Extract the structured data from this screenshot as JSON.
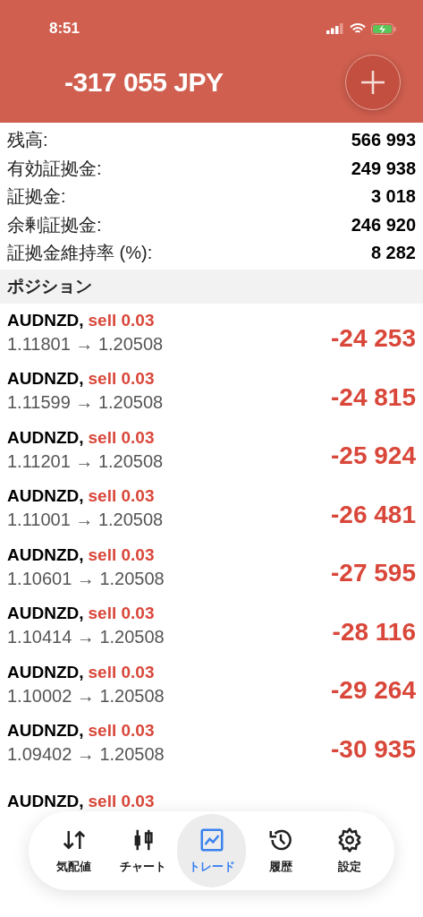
{
  "status_bar": {
    "time": "8:51"
  },
  "header": {
    "balance": "-317 055 JPY"
  },
  "summary": [
    {
      "label": "残高:",
      "value": "566 993"
    },
    {
      "label": "有効証拠金:",
      "value": "249 938"
    },
    {
      "label": "証拠金:",
      "value": "3 018"
    },
    {
      "label": "余剰証拠金:",
      "value": "246 920"
    },
    {
      "label": "証拠金維持率 (%):",
      "value": "8 282"
    }
  ],
  "positions": {
    "title": "ポジション",
    "rows": [
      {
        "symbol": "AUDNZD,",
        "trade": "sell 0.03",
        "prices": "1.11801 → 1.20508",
        "profit": "-24 253"
      },
      {
        "symbol": "AUDNZD,",
        "trade": "sell 0.03",
        "prices": "1.11599 → 1.20508",
        "profit": "-24 815"
      },
      {
        "symbol": "AUDNZD,",
        "trade": "sell 0.03",
        "prices": "1.11201 → 1.20508",
        "profit": "-25 924"
      },
      {
        "symbol": "AUDNZD,",
        "trade": "sell 0.03",
        "prices": "1.11001 → 1.20508",
        "profit": "-26 481"
      },
      {
        "symbol": "AUDNZD,",
        "trade": "sell 0.03",
        "prices": "1.10601 → 1.20508",
        "profit": "-27 595"
      },
      {
        "symbol": "AUDNZD,",
        "trade": "sell 0.03",
        "prices": "1.10414 → 1.20508",
        "profit": "-28 116"
      },
      {
        "symbol": "AUDNZD,",
        "trade": "sell 0.03",
        "prices": "1.10002 → 1.20508",
        "profit": "-29 264"
      },
      {
        "symbol": "AUDNZD,",
        "trade": "sell 0.03",
        "prices": "1.09402 → 1.20508",
        "profit": "-30 935"
      },
      {
        "symbol": "AUDNZD,",
        "trade": "sell 0.03"
      }
    ]
  },
  "tab_bar": [
    {
      "label": "気配値",
      "selected": false
    },
    {
      "label": "チャート",
      "selected": false
    },
    {
      "label": "トレード",
      "selected": true
    },
    {
      "label": "履歴",
      "selected": false
    },
    {
      "label": "設定",
      "selected": false
    }
  ]
}
